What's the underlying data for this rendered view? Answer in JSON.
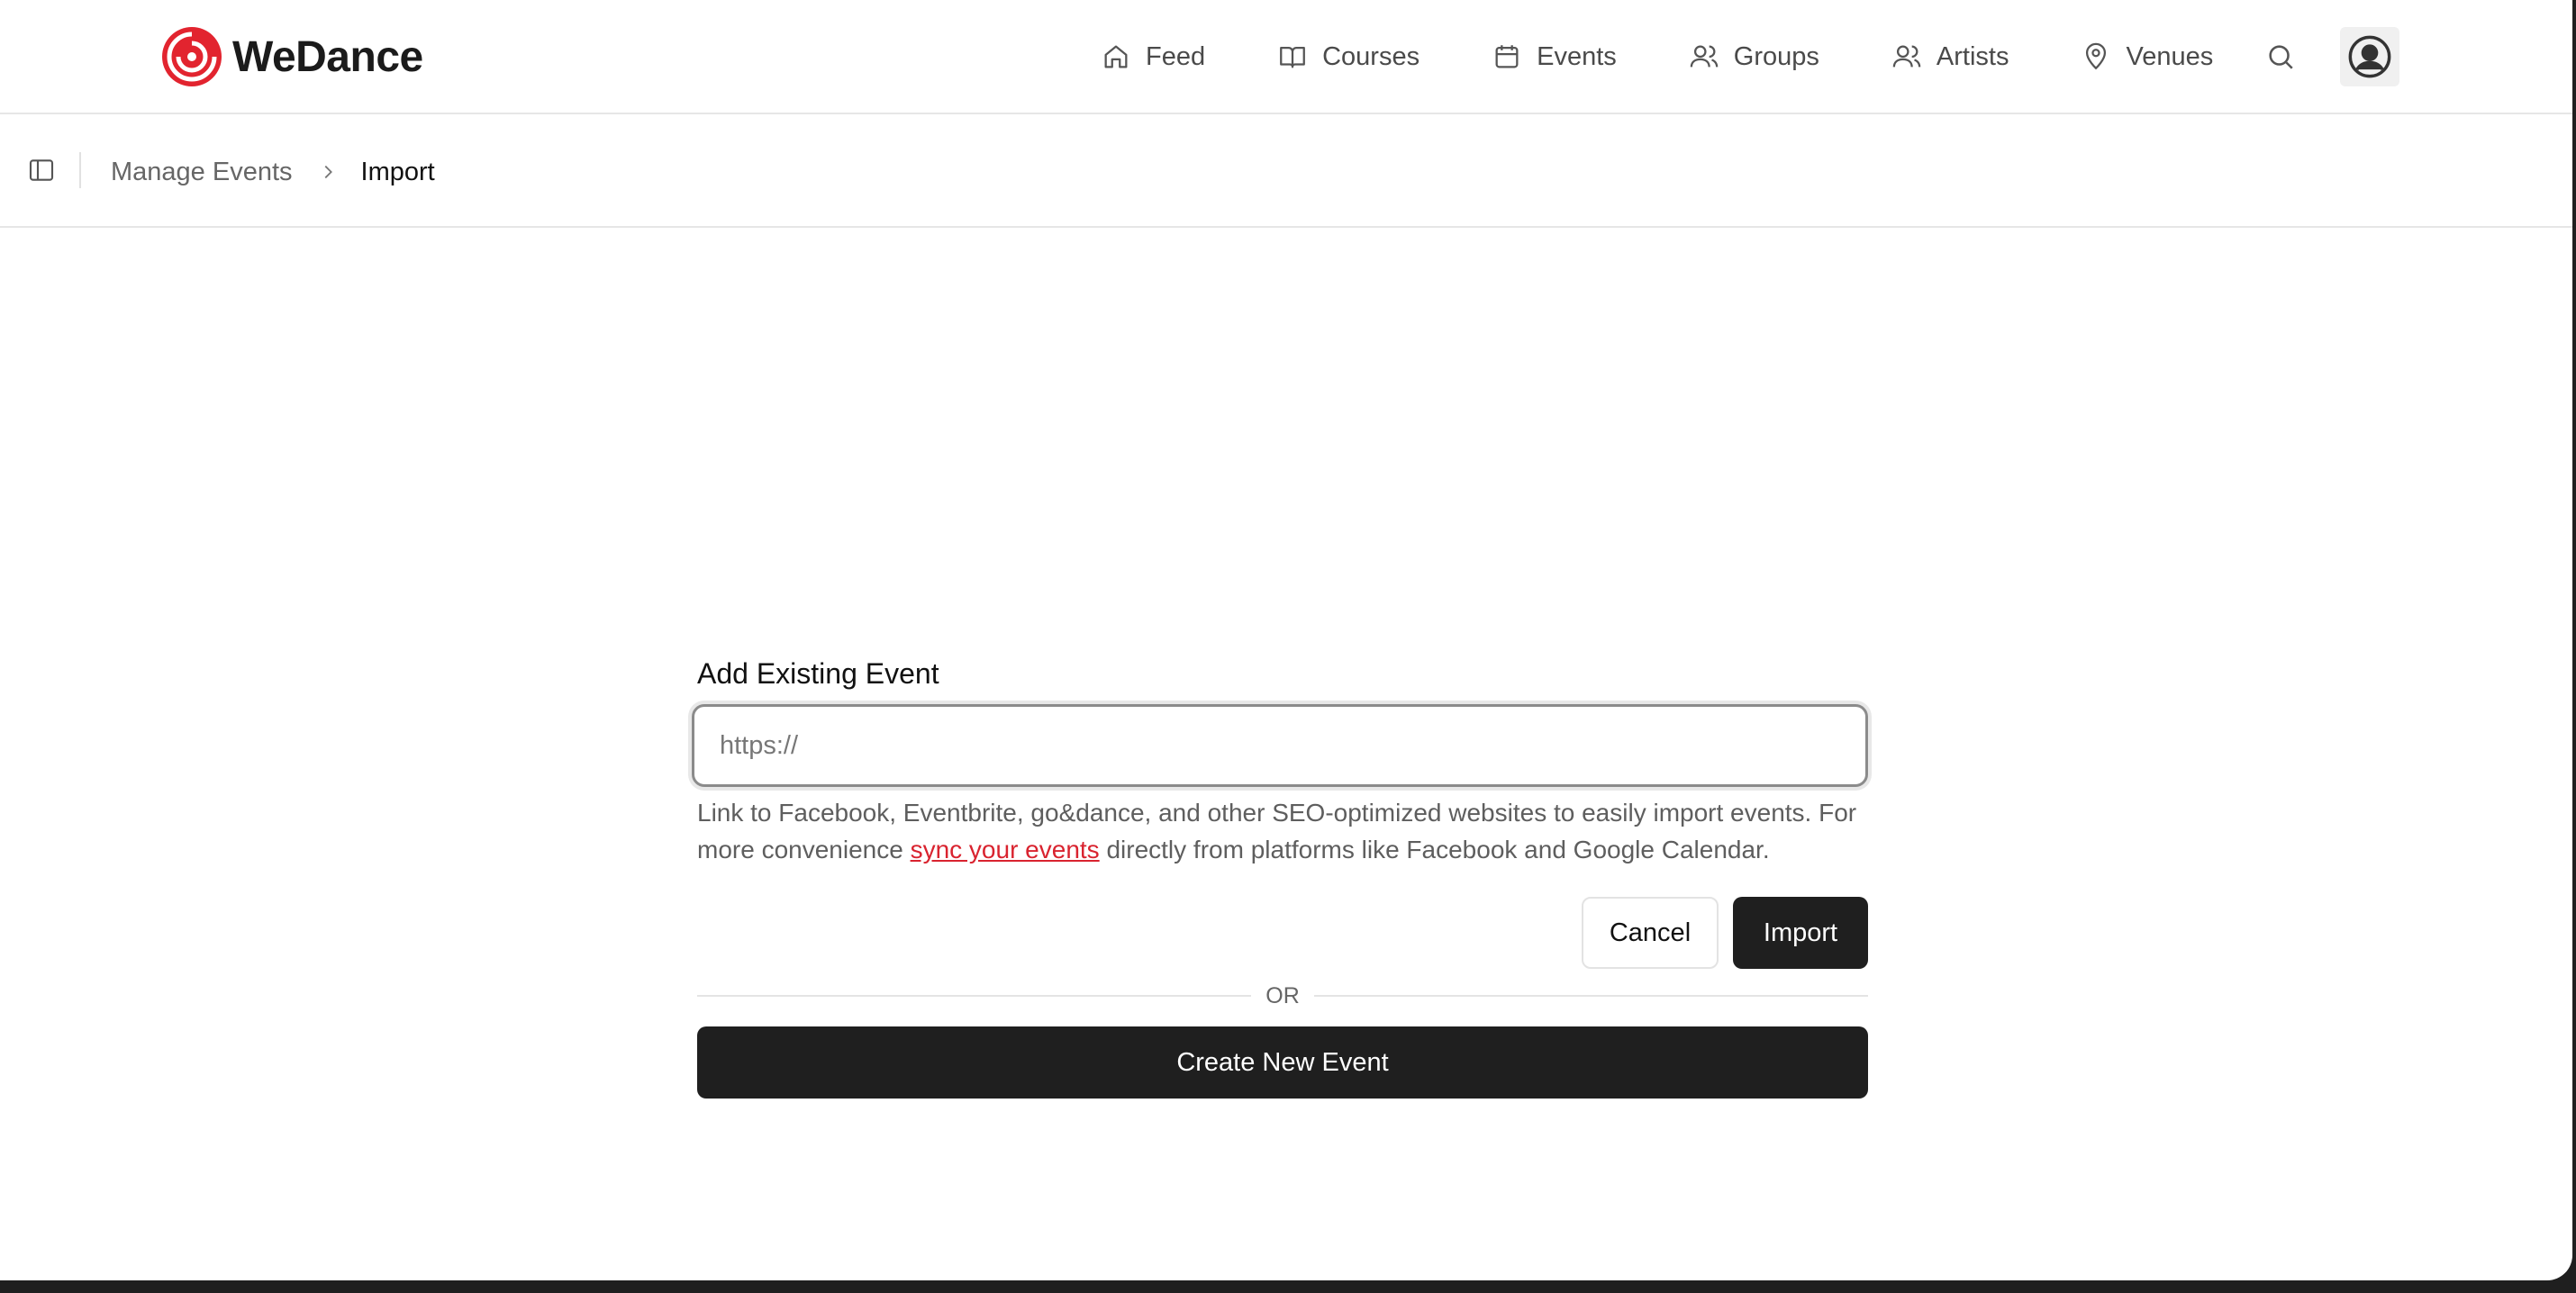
{
  "app": {
    "logo_text": "WeDance",
    "brand_color": "#e2242f"
  },
  "nav": {
    "items": [
      {
        "label": "Feed",
        "icon": "home-icon"
      },
      {
        "label": "Courses",
        "icon": "book-open-icon"
      },
      {
        "label": "Events",
        "icon": "calendar-icon"
      },
      {
        "label": "Groups",
        "icon": "users-icon"
      },
      {
        "label": "Artists",
        "icon": "user-group-icon"
      },
      {
        "label": "Venues",
        "icon": "map-pin-icon"
      }
    ],
    "search_icon": "search-icon",
    "profile_icon": "user-circle-icon"
  },
  "breadcrumb": {
    "parent": "Manage Events",
    "current": "Import"
  },
  "form": {
    "title": "Add Existing Event",
    "url_placeholder": "https://",
    "url_value": "",
    "help_before": "Link to Facebook, Eventbrite, go&dance, and other SEO-optimized websites to easily import events. For more convenience ",
    "help_link": "sync your events",
    "help_after": " directly from platforms like Facebook and Google Calendar.",
    "cancel_label": "Cancel",
    "import_label": "Import",
    "or_label": "OR",
    "create_label": "Create New Event"
  }
}
